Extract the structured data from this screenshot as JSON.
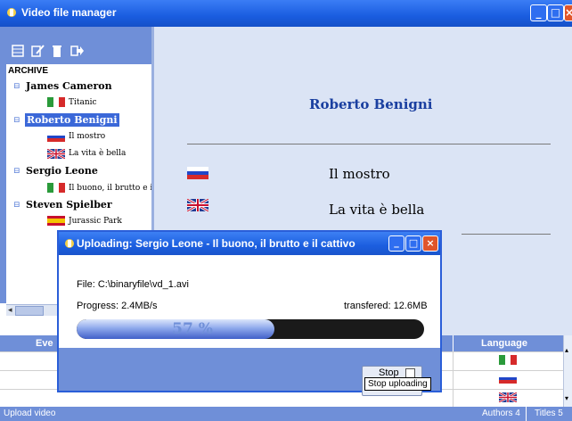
{
  "window": {
    "title": "Video file manager"
  },
  "toolbar": {
    "icons": [
      "table-icon",
      "edit-icon",
      "delete-icon",
      "export-icon"
    ]
  },
  "tree": {
    "root_label": "ARCHIVE",
    "nodes": [
      {
        "label": "James Cameron",
        "children": [
          {
            "label": "Titanic",
            "flag": "italy"
          }
        ]
      },
      {
        "label": "Roberto Benigni",
        "selected": true,
        "children": [
          {
            "label": "Il mostro",
            "flag": "russia"
          },
          {
            "label": "La vita è bella",
            "flag": "uk"
          }
        ]
      },
      {
        "label": "Sergio Leone",
        "children": [
          {
            "label": "Il buono, il brutto e il cat",
            "flag": "italy"
          }
        ]
      },
      {
        "label": "Steven Spielber",
        "children": [
          {
            "label": "Jurassic Park",
            "flag": "spain"
          }
        ]
      }
    ]
  },
  "detail": {
    "name": "Roberto Benigni",
    "films": [
      {
        "title": "Il mostro",
        "flag": "russia"
      },
      {
        "title": "La vita è bella",
        "flag": "uk"
      }
    ]
  },
  "table": {
    "headers": [
      "Eve",
      "Language"
    ],
    "rows": [
      {
        "flag": "italy"
      },
      {
        "flag": "russia"
      },
      {
        "flag": "uk"
      }
    ]
  },
  "status": {
    "left": "Upload video",
    "authors": "Authors 4",
    "titles": "Titles 5"
  },
  "dialog": {
    "title": "Uploading: Sergio Leone - Il buono, il brutto e il cattivo",
    "file_label": "File: C:\\binaryfile\\vd_1.avi",
    "progress_label": "Progress: 2.4MB/s",
    "transferred_label": "transfered: 12.6MB",
    "progress_percent_text": "57 %",
    "progress_fraction": 0.57,
    "stop_label": "Stop",
    "stop_tooltip": "Stop uploading"
  },
  "colors": {
    "accent": "#2a5ed8",
    "panel": "#6f8fd8",
    "content_bg": "#dbe4f5"
  }
}
